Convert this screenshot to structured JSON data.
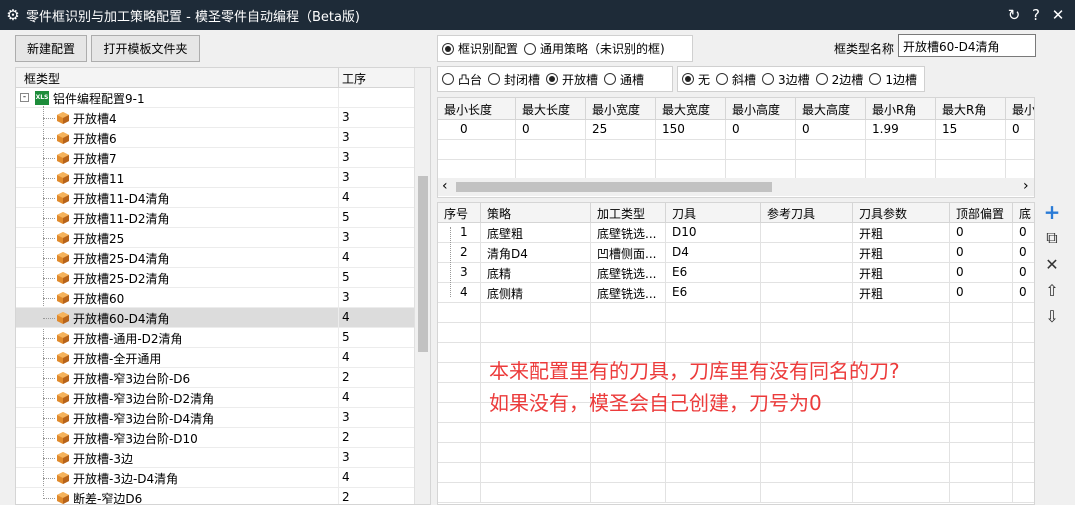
{
  "window": {
    "title": "零件框识别与加工策略配置 - 模圣零件自动编程（Beta版)",
    "refresh_glyph": "↻",
    "help_glyph": "?",
    "close_glyph": "✕",
    "gear_glyph": "⚙"
  },
  "toolbar": {
    "new_config": "新建配置",
    "open_template_folder": "打开模板文件夹"
  },
  "tree": {
    "col_type": "框类型",
    "col_op": "工序",
    "root": {
      "label": "铝件编程配置9-1",
      "icon_text": "XLS"
    },
    "items": [
      {
        "label": "开放槽4",
        "op": "3"
      },
      {
        "label": "开放槽6",
        "op": "3"
      },
      {
        "label": "开放槽7",
        "op": "3"
      },
      {
        "label": "开放槽11",
        "op": "3"
      },
      {
        "label": "开放槽11-D4清角",
        "op": "4"
      },
      {
        "label": "开放槽11-D2清角",
        "op": "5"
      },
      {
        "label": "开放槽25",
        "op": "3"
      },
      {
        "label": "开放槽25-D4清角",
        "op": "4"
      },
      {
        "label": "开放槽25-D2清角",
        "op": "5"
      },
      {
        "label": "开放槽60",
        "op": "3"
      },
      {
        "label": "开放槽60-D4清角",
        "op": "4"
      },
      {
        "label": "开放槽-通用-D2清角",
        "op": "5"
      },
      {
        "label": "开放槽-全开通用",
        "op": "4"
      },
      {
        "label": "开放槽-窄3边台阶-D6",
        "op": "2"
      },
      {
        "label": "开放槽-窄3边台阶-D2清角",
        "op": "4"
      },
      {
        "label": "开放槽-窄3边台阶-D4清角",
        "op": "3"
      },
      {
        "label": "开放槽-窄3边台阶-D10",
        "op": "2"
      },
      {
        "label": "开放槽-3边",
        "op": "3"
      },
      {
        "label": "开放槽-3边-D4清角",
        "op": "4"
      },
      {
        "label": "断差-窄边D6",
        "op": "2"
      }
    ],
    "selected_index": 10
  },
  "mode": {
    "options": [
      "框识别配置",
      "通用策略（未识别的框)"
    ],
    "selected": 0
  },
  "frame_type_name": {
    "label": "框类型名称",
    "value": "开放槽60-D4清角"
  },
  "shape": {
    "options": [
      "凸台",
      "封闭槽",
      "开放槽",
      "通槽"
    ],
    "selected": 2
  },
  "edge": {
    "options": [
      "无",
      "斜槽",
      "3边槽",
      "2边槽",
      "1边槽"
    ],
    "selected": 0
  },
  "limits": {
    "headers": [
      "最小长度",
      "最大长度",
      "最小宽度",
      "最大宽度",
      "最小高度",
      "最大高度",
      "最小R角",
      "最大R角",
      "最小"
    ],
    "row": [
      "0",
      "0",
      "25",
      "150",
      "0",
      "0",
      "1.99",
      "15",
      "0"
    ]
  },
  "strategy": {
    "headers": [
      "序号",
      "策略",
      "加工类型",
      "刀具",
      "参考刀具",
      "刀具参数",
      "顶部偏置",
      "底"
    ],
    "rows": [
      [
        "1",
        "底壁粗",
        "底壁铣选...",
        "D10",
        "",
        "开粗",
        "0",
        "0"
      ],
      [
        "2",
        "清角D4",
        "凹槽侧面...",
        "D4",
        "",
        "开粗",
        "0",
        "0"
      ],
      [
        "3",
        "底精",
        "底壁铣选...",
        "E6",
        "",
        "开粗",
        "0",
        "0"
      ],
      [
        "4",
        "底侧精",
        "底壁铣选...",
        "E6",
        "",
        "开粗",
        "0",
        "0"
      ]
    ]
  },
  "side_buttons": [
    {
      "name": "add-row-button",
      "glyph": "+",
      "color": "#2a7bd6"
    },
    {
      "name": "copy-row-button",
      "glyph": "⧉",
      "color": "#333333"
    },
    {
      "name": "delete-row-button",
      "glyph": "✕",
      "color": "#333333"
    },
    {
      "name": "move-up-button",
      "glyph": "⇧",
      "color": "#333333"
    },
    {
      "name": "move-down-button",
      "glyph": "⇩",
      "color": "#333333"
    }
  ],
  "annotation": {
    "line1": "本来配置里有的刀具，刀库里有没有同名的刀?",
    "line2": "如果没有，模圣会自己创建，刀号为0"
  },
  "scroll": {
    "left_glyph": "‹",
    "right_glyph": "›"
  },
  "colors": {
    "titlebar": "#1e2b38",
    "annotation": "#ec3b3b",
    "selected_row": "#dcdcdc"
  }
}
